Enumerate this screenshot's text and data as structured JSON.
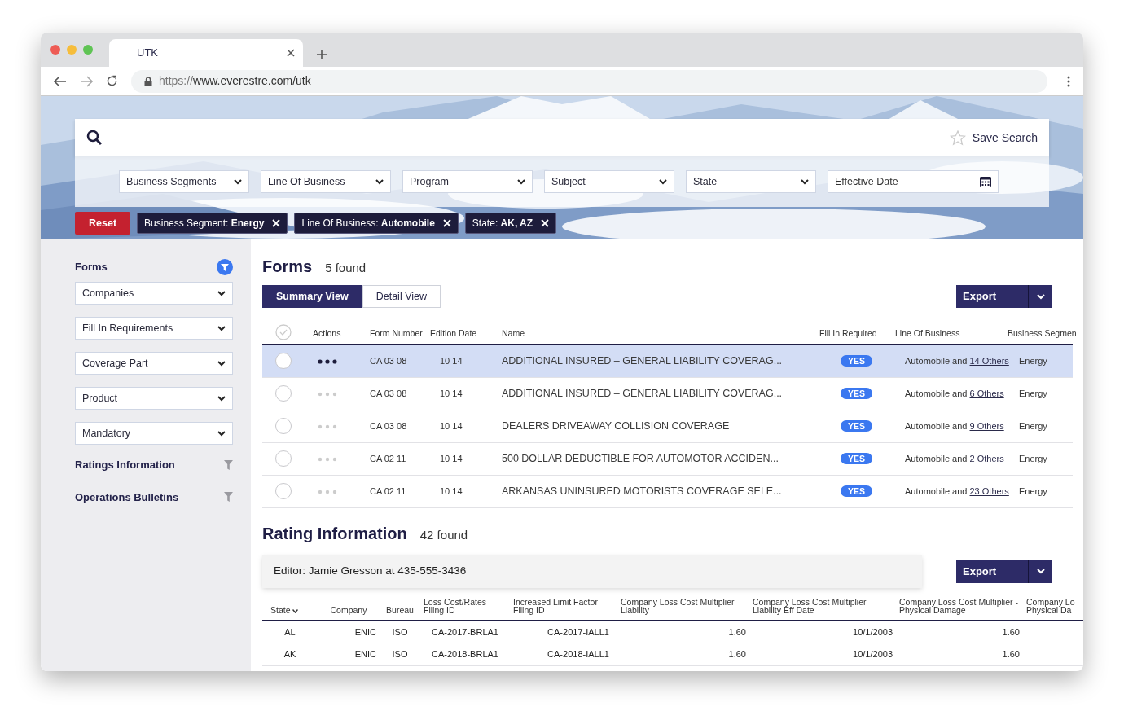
{
  "browser": {
    "tab_title": "UTK",
    "url_scheme": "https://",
    "url_rest": "www.everestre.com/utk"
  },
  "search": {
    "save_label": "Save Search",
    "filters": [
      "Business Segments",
      "Line Of Business",
      "Program",
      "Subject",
      "State"
    ],
    "date_placeholder": "Effective Date"
  },
  "chips_bar": {
    "reset": "Reset",
    "chips": [
      {
        "label": "Business Segment:",
        "value": "Energy"
      },
      {
        "label": "Line Of Business:",
        "value": "Automobile"
      },
      {
        "label": "State:",
        "value": "AK, AZ"
      }
    ]
  },
  "sidebar": {
    "sections": [
      {
        "title": "Forms",
        "filter_active": true,
        "dropdowns": [
          "Companies",
          "Fill In Requirements",
          "Coverage Part",
          "Product",
          "Mandatory"
        ]
      },
      {
        "title": "Ratings Information",
        "filter_active": false
      },
      {
        "title": "Operations Bulletins",
        "filter_active": false
      }
    ]
  },
  "forms": {
    "title": "Forms",
    "count": "5 found",
    "all_selected": false,
    "views": [
      {
        "label": "Summary View",
        "selected": true
      },
      {
        "label": "Detail View",
        "selected": false
      }
    ],
    "export": "Export",
    "columns": [
      "Actions",
      "Form Number",
      "Edition Date",
      "Name",
      "Fill In Required",
      "Line Of Business",
      "Business Segmen"
    ],
    "rows": [
      {
        "selected": true,
        "form_number": "CA 03 08",
        "edition": "10 14",
        "name": "ADDITIONAL INSURED – GENERAL LIABILITY COVERAG...",
        "fill": "YES",
        "lob": "Automobile and",
        "others": "14 Others",
        "segment": "Energy"
      },
      {
        "selected": false,
        "form_number": "CA 03 08",
        "edition": "10 14",
        "name": "ADDITIONAL INSURED – GENERAL LIABILITY COVERAG...",
        "fill": "YES",
        "lob": "Automobile and",
        "others": "6 Others",
        "segment": "Energy"
      },
      {
        "selected": false,
        "form_number": "CA 03 08",
        "edition": "10 14",
        "name": "DEALERS DRIVEAWAY COLLISION COVERAGE",
        "fill": "YES",
        "lob": "Automobile and",
        "others": "9 Others",
        "segment": "Energy"
      },
      {
        "selected": false,
        "form_number": "CA 02 11",
        "edition": "10 14",
        "name": "500 DOLLAR DEDUCTIBLE FOR AUTOMOTOR ACCIDEN...",
        "fill": "YES",
        "lob": "Automobile and",
        "others": "2 Others",
        "segment": "Energy"
      },
      {
        "selected": false,
        "form_number": "CA 02 11",
        "edition": "10 14",
        "name": "ARKANSAS UNINSURED MOTORISTS COVERAGE SELE...",
        "fill": "YES",
        "lob": "Automobile and",
        "others": "23 Others",
        "segment": "Energy"
      }
    ]
  },
  "rating": {
    "title": "Rating Information",
    "count": "42 found",
    "editor": "Editor: Jamie Gresson at 435-555-3436",
    "export": "Export",
    "columns": [
      "State",
      "Company",
      "Bureau",
      "Loss Cost/Rates Filing ID",
      "Increased Limit Factor Filing ID",
      "Company Loss Cost Multiplier Liability",
      "Company Loss Cost Multiplier Liability Eff Date",
      "Company Loss Cost Multiplier - Physical Damage",
      "Company Lo Physical Da"
    ],
    "rows": [
      [
        "AL",
        "ENIC",
        "ISO",
        "CA-2017-BRLA1",
        "CA-2017-IALL1",
        "1.60",
        "10/1/2003",
        "1.60"
      ],
      [
        "AK",
        "ENIC",
        "ISO",
        "CA-2018-BRLA1",
        "CA-2018-IALL1",
        "1.60",
        "10/1/2003",
        "1.60"
      ]
    ]
  }
}
